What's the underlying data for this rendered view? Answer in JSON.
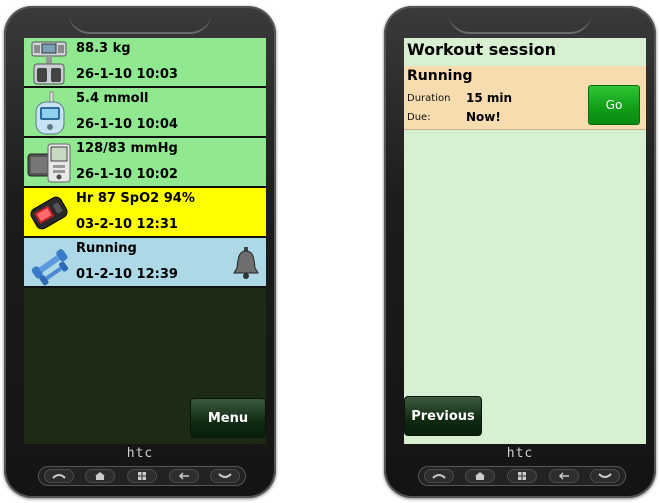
{
  "left_phone": {
    "rows": [
      {
        "line1": "88.3 kg",
        "line2": "26-1-10 10:03",
        "icon": "body-scale-icon",
        "bg": "#90e890"
      },
      {
        "line1": "5.4 mmoll",
        "line2": "26-1-10 10:04",
        "icon": "glucose-meter-icon",
        "bg": "#90e890"
      },
      {
        "line1": "128/83 mmHg",
        "line2": "26-1-10 10:02",
        "icon": "blood-pressure-monitor-icon",
        "bg": "#90e890"
      },
      {
        "line1": "Hr 87 SpO2 94%",
        "line2": "03-2-10 12:31",
        "icon": "pulse-oximeter-icon",
        "bg": "#ffff00"
      },
      {
        "line1": "Running",
        "line2": "01-2-10 12:39",
        "icon": "dumbbell-icon",
        "bg": "#add8e6",
        "reminder_icon": "bell-icon"
      }
    ],
    "menu_label": "Menu",
    "brand": "htc"
  },
  "right_phone": {
    "title": "Workout session",
    "session": {
      "name": "Running",
      "duration_label": "Duration",
      "duration_value": "15 min",
      "due_label": "Due:",
      "due_value": "Now!"
    },
    "go_label": "Go",
    "previous_label": "Previous",
    "brand": "htc"
  },
  "hardware_keys": [
    "call-icon",
    "home-icon",
    "windows-icon",
    "back-icon",
    "end-call-icon"
  ]
}
